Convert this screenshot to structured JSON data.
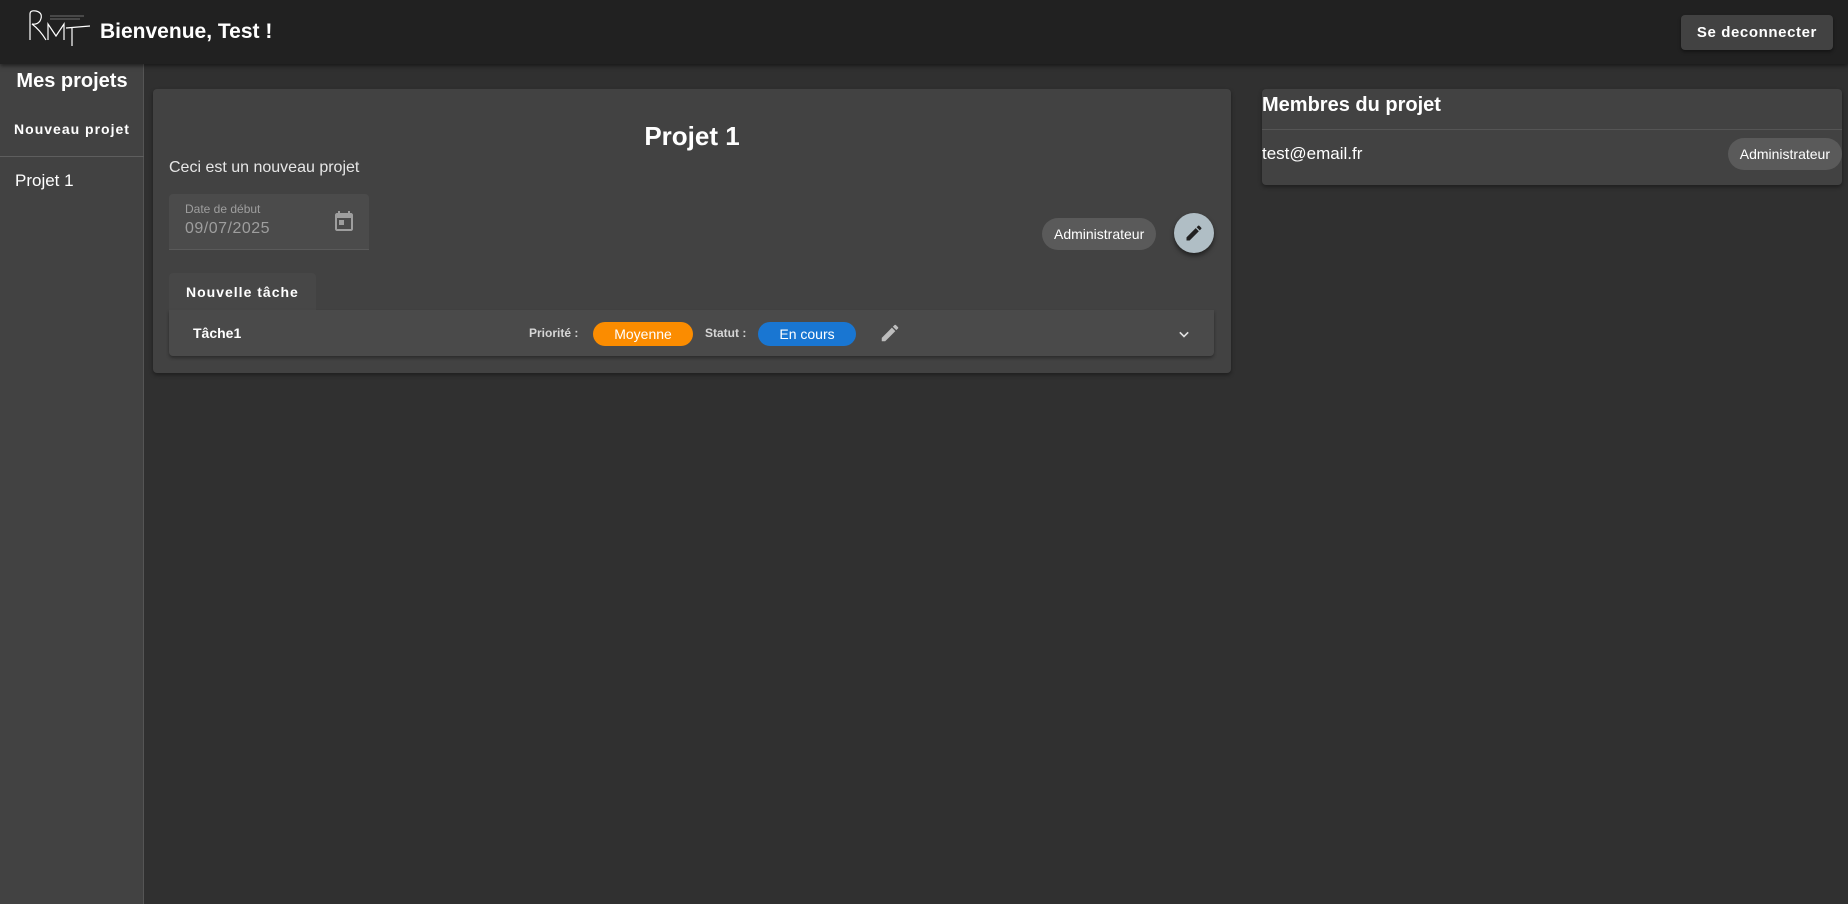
{
  "header": {
    "welcome_text": "Bienvenue, Test !",
    "logout_label": "Se deconnecter"
  },
  "sidebar": {
    "title": "Mes projets",
    "new_project_label": "Nouveau projet",
    "projects": [
      {
        "label": "Projet 1"
      }
    ]
  },
  "project": {
    "title": "Projet 1",
    "description": "Ceci est un nouveau projet",
    "start_date_label": "Date de début",
    "start_date_value": "09/07/2025",
    "role": "Administrateur",
    "new_task_label": "Nouvelle tâche",
    "tasks": [
      {
        "name": "Tâche1",
        "priority_label": "Priorité :",
        "priority": "Moyenne",
        "status_label": "Statut :",
        "status": "En cours"
      }
    ]
  },
  "members": {
    "title": "Membres du projet",
    "list": [
      {
        "email": "test@email.fr",
        "role": "Administrateur"
      }
    ]
  },
  "colors": {
    "background": "#303030",
    "topbar": "#212121",
    "surface": "#424242",
    "priority_medium": "#fb8c00",
    "status_in_progress": "#1976d2",
    "edit_fab": "#b0bec5"
  },
  "icons": {
    "date_picker": "calendar-icon",
    "project_edit": "pencil-icon",
    "task_edit": "pencil-icon",
    "task_expand": "chevron-down-icon"
  }
}
